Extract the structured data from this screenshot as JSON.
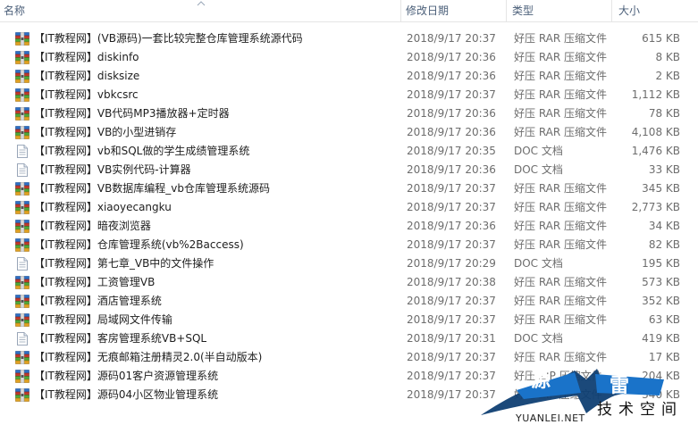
{
  "columns": {
    "name": "名称",
    "date": "修改日期",
    "type": "类型",
    "size": "大小"
  },
  "files": [
    {
      "name": "【IT教程网】(VB源码)一套比较完整仓库管理系统源代码",
      "date": "2018/9/17 20:37",
      "type": "好压 RAR 压缩文件",
      "size": "615 KB",
      "icon": "rar-archive-icon"
    },
    {
      "name": "【IT教程网】diskinfo",
      "date": "2018/9/17 20:36",
      "type": "好压 RAR 压缩文件",
      "size": "8 KB",
      "icon": "rar-archive-icon"
    },
    {
      "name": "【IT教程网】disksize",
      "date": "2018/9/17 20:36",
      "type": "好压 RAR 压缩文件",
      "size": "2 KB",
      "icon": "rar-archive-icon"
    },
    {
      "name": "【IT教程网】vbkcsrc",
      "date": "2018/9/17 20:37",
      "type": "好压 RAR 压缩文件",
      "size": "1,112 KB",
      "icon": "rar-archive-icon"
    },
    {
      "name": "【IT教程网】VB代码MP3播放器+定时器",
      "date": "2018/9/17 20:36",
      "type": "好压 RAR 压缩文件",
      "size": "78 KB",
      "icon": "rar-archive-icon"
    },
    {
      "name": "【IT教程网】VB的小型进销存",
      "date": "2018/9/17 20:36",
      "type": "好压 RAR 压缩文件",
      "size": "4,108 KB",
      "icon": "rar-archive-icon"
    },
    {
      "name": "【IT教程网】vb和SQL做的学生成绩管理系统",
      "date": "2018/9/17 20:35",
      "type": "DOC 文档",
      "size": "1,476 KB",
      "icon": "doc-file-icon"
    },
    {
      "name": "【IT教程网】VB实例代码-计算器",
      "date": "2018/9/17 20:36",
      "type": "DOC 文档",
      "size": "33 KB",
      "icon": "doc-file-icon"
    },
    {
      "name": "【IT教程网】VB数据库编程_vb仓库管理系统源码",
      "date": "2018/9/17 20:37",
      "type": "好压 RAR 压缩文件",
      "size": "345 KB",
      "icon": "rar-archive-icon"
    },
    {
      "name": "【IT教程网】xiaoyecangku",
      "date": "2018/9/17 20:37",
      "type": "好压 RAR 压缩文件",
      "size": "2,773 KB",
      "icon": "rar-archive-icon"
    },
    {
      "name": "【IT教程网】暗夜浏览器",
      "date": "2018/9/17 20:36",
      "type": "好压 RAR 压缩文件",
      "size": "34 KB",
      "icon": "rar-archive-icon"
    },
    {
      "name": "【IT教程网】仓库管理系统(vb%2Baccess)",
      "date": "2018/9/17 20:37",
      "type": "好压 RAR 压缩文件",
      "size": "82 KB",
      "icon": "rar-archive-icon"
    },
    {
      "name": "【IT教程网】第七章_VB中的文件操作",
      "date": "2018/9/17 20:29",
      "type": "DOC 文档",
      "size": "195 KB",
      "icon": "doc-file-icon"
    },
    {
      "name": "【IT教程网】工资管理VB",
      "date": "2018/9/17 20:38",
      "type": "好压 RAR 压缩文件",
      "size": "573 KB",
      "icon": "rar-archive-icon"
    },
    {
      "name": "【IT教程网】酒店管理系统",
      "date": "2018/9/17 20:37",
      "type": "好压 RAR 压缩文件",
      "size": "352 KB",
      "icon": "rar-archive-icon"
    },
    {
      "name": "【IT教程网】局域网文件传输",
      "date": "2018/9/17 20:37",
      "type": "好压 RAR 压缩文件",
      "size": "63 KB",
      "icon": "rar-archive-icon"
    },
    {
      "name": "【IT教程网】客房管理系统VB+SQL",
      "date": "2018/9/17 20:31",
      "type": "DOC 文档",
      "size": "419 KB",
      "icon": "doc-file-icon"
    },
    {
      "name": "【IT教程网】无痕邮箱注册精灵2.0(半自动版本)",
      "date": "2018/9/17 20:37",
      "type": "好压 RAR 压缩文件",
      "size": "17 KB",
      "icon": "rar-archive-icon"
    },
    {
      "name": "【IT教程网】源码01客户资源管理系统",
      "date": "2018/9/17 20:37",
      "type": "好压 ZIP 压缩文件",
      "size": "204 KB",
      "icon": "rar-archive-icon"
    },
    {
      "name": "【IT教程网】源码04小区物业管理系统",
      "date": "2018/9/17 20:37",
      "type": "好压 ZIP 压缩文件",
      "size": "340 KB",
      "icon": "rar-archive-icon"
    }
  ],
  "watermark": {
    "char1": "源",
    "char2": "雷",
    "tagline": "技术空间",
    "url": "YUANLEI.NET"
  },
  "colors": {
    "header_text": "#4c607a",
    "secondary_text": "#6d6d6d",
    "watermark_blue": "#1a73c9"
  }
}
